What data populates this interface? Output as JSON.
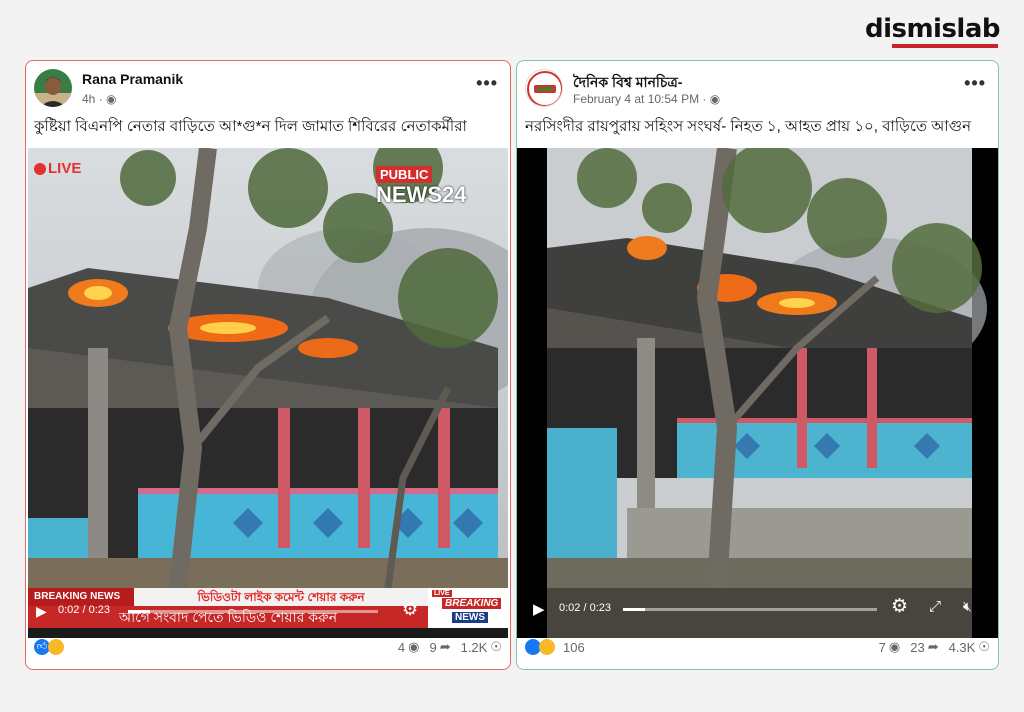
{
  "brand": {
    "logo_text": "dismislab",
    "accent": "#c8242b"
  },
  "posts": [
    {
      "author": "Rana Pramanik",
      "time": "4h",
      "caption": "কুষ্টিয়া বিএনপি নেতার বাড়িতে আ*গু*ন দিল জামাত শিবিরের নেতাকর্মীরা",
      "video": {
        "live_label": "LIVE",
        "channel_top": "PUBLIC",
        "channel_bottom": "NEWS24",
        "breaking_label": "BREAKING NEWS",
        "ticker_line1": "ভিডিওটা লাইক কমেন্ট শেয়ার করুন",
        "ticker_line2": "আগে সংবাদ পেতে ভিডিও শেয়ার  করুন",
        "time_display": "0:02 / 0:23",
        "progress": 0.087,
        "corner_logo_top": "LIVE",
        "corner_logo_mid": "BREAKING",
        "corner_logo_bot": "NEWS"
      },
      "stats": {
        "comments": "4",
        "shares": "9",
        "views": "1.2K"
      },
      "border_color": "#e06a6a"
    },
    {
      "author": "দৈনিক বিশ্ব মানচিত্র-",
      "time": "February 4 at 10:54 PM",
      "caption": "নরসিংদীর রায়পুরায় সহিংস সংঘর্ষ- নিহত ১, আহত প্রায় ১০, বাড়িতে আগুন",
      "video": {
        "time_display": "0:02 / 0:23",
        "progress": 0.087
      },
      "stats": {
        "reactions": "106",
        "comments": "7",
        "shares": "23",
        "views": "4.3K"
      },
      "border_color": "#7fc9a9"
    }
  ]
}
